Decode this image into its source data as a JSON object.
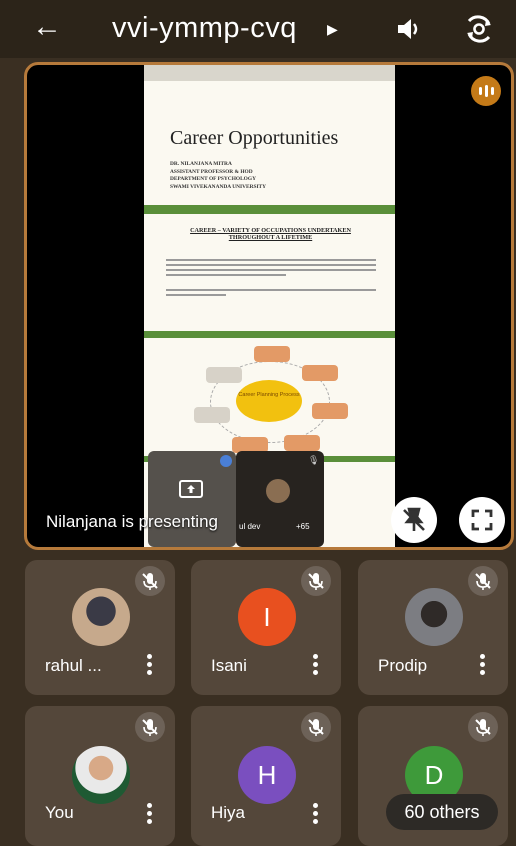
{
  "topbar": {
    "meeting_code": "vvi-ymmp-cvq",
    "back_icon": "arrow-left-icon",
    "speaker_icon": "speaker-icon",
    "camera_icon": "camera-flip-icon"
  },
  "stage": {
    "presenting_label": "Nilanjana is presenting",
    "slide": {
      "title": "Career Opportunities",
      "author_lines": [
        "DR. NILANJANA MITRA",
        "ASSISTANT PROFESSOR & HOD",
        "DEPARTMENT OF PSYCHOLOGY",
        "SWAMI VIVEKANANDA UNIVERSITY"
      ],
      "heading": "CAREER – VARIETY OF OCCUPATIONS UNDERTAKEN THROUGHOUT A LIFETIME",
      "diagram_center": "Career Planning Process"
    },
    "self_tile": {
      "icon": "screen-share-icon"
    },
    "other_tile": {
      "label": "ul dev",
      "count": "+65"
    }
  },
  "participants": [
    {
      "name": "rahul ...",
      "avatar_type": "photo",
      "muted": true
    },
    {
      "name": "Isani",
      "letter": "I",
      "color": "#e8501f",
      "muted": true
    },
    {
      "name": "Prodip",
      "avatar_type": "photo",
      "muted": true
    },
    {
      "name": "You",
      "avatar_type": "photo",
      "muted": true
    },
    {
      "name": "Hiya",
      "letter": "H",
      "color": "#7a4fbf",
      "muted": true
    },
    {
      "name": "D",
      "letter": "D",
      "color": "#3e9a3a",
      "muted": true
    }
  ],
  "others_pill": "60 others",
  "colors": {
    "accent_border": "#b67a3b",
    "tile_bg": "#54473a",
    "slide_green": "#5a8f3a"
  }
}
